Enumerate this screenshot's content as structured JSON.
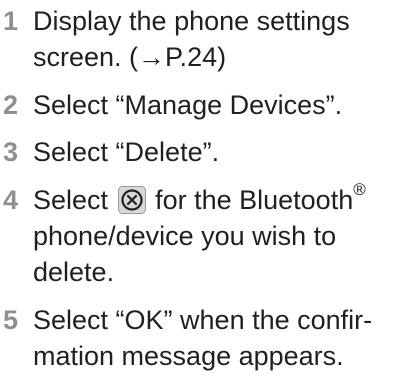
{
  "steps": [
    {
      "number": "1",
      "lines": [
        "Display the phone settings",
        "screen. (→P.24)"
      ]
    },
    {
      "number": "2",
      "lines": [
        "Select “Manage Devices”."
      ]
    },
    {
      "number": "3",
      "lines": [
        "Select “Delete”."
      ]
    },
    {
      "number": "4",
      "line1_before": "Select",
      "line1_after": "for the Bluetooth",
      "line1_sup": "®",
      "icon": "delete-circle-x-icon",
      "lines": [
        "phone/device you wish to",
        "delete."
      ]
    },
    {
      "number": "5",
      "lines": [
        "Select “OK” when the confir-",
        "mation message appears."
      ]
    }
  ]
}
